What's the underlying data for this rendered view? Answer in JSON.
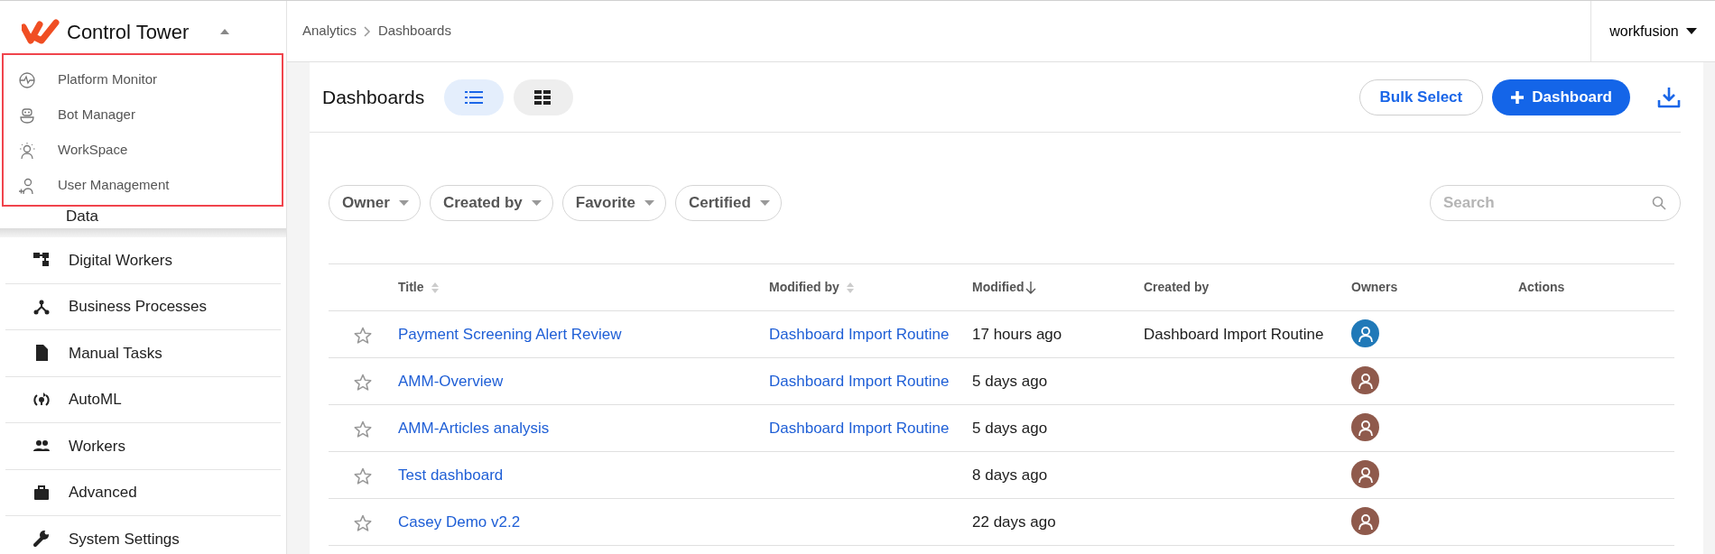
{
  "app": {
    "title": "Control Tower"
  },
  "app_menu": {
    "expanded": true,
    "items": [
      {
        "label": "Platform Monitor"
      },
      {
        "label": "Bot Manager"
      },
      {
        "label": "WorkSpace"
      },
      {
        "label": "User Management"
      }
    ]
  },
  "sidebar": {
    "items": [
      {
        "label": "Data"
      },
      {
        "label": "Digital Workers"
      },
      {
        "label": "Business Processes"
      },
      {
        "label": "Manual Tasks"
      },
      {
        "label": "AutoML"
      },
      {
        "label": "Workers"
      },
      {
        "label": "Advanced"
      },
      {
        "label": "System Settings"
      }
    ]
  },
  "breadcrumb": [
    "Analytics",
    "Dashboards"
  ],
  "user_menu": {
    "label": "workfusion"
  },
  "page": {
    "title": "Dashboards",
    "views": [
      {
        "kind": "list",
        "selected": true
      },
      {
        "kind": "grid",
        "selected": false
      }
    ],
    "buttons": [
      {
        "kind": "outline",
        "label": "Bulk Select"
      },
      {
        "kind": "primary",
        "label": "Dashboard"
      }
    ]
  },
  "filters": [
    "Owner",
    "Created by",
    "Favorite",
    "Certified"
  ],
  "search": {
    "placeholder": "Search"
  },
  "table": {
    "columns": [
      {
        "label": "Title",
        "sortable": true,
        "sorted_descending": false
      },
      {
        "label": "Modified by",
        "sortable": true,
        "sorted_descending": false
      },
      {
        "label": "Modified",
        "sortable": false,
        "sorted_descending": true
      },
      {
        "label": "Created by",
        "sortable": false,
        "sorted_descending": false
      },
      {
        "label": "Owners",
        "sortable": false,
        "sorted_descending": false
      },
      {
        "label": "Actions",
        "sortable": false,
        "sorted_descending": false
      }
    ],
    "rows": [
      {
        "favorite": false,
        "title": "Payment Screening Alert Review",
        "modified_by": "Dashboard Import Routine",
        "modified": "17 hours ago",
        "created_by": "Dashboard Import Routine",
        "owners": [
          {
            "color": "#2079b8"
          }
        ]
      },
      {
        "favorite": false,
        "title": "AMM-Overview",
        "modified_by": "Dashboard Import Routine",
        "modified": "5 days ago",
        "owners": [
          {
            "color": "#8f5a4c"
          }
        ]
      },
      {
        "favorite": false,
        "title": "AMM-Articles analysis",
        "modified_by": "Dashboard Import Routine",
        "modified": "5 days ago",
        "owners": [
          {
            "color": "#8f5a4c"
          }
        ]
      },
      {
        "favorite": false,
        "title": "Test dashboard",
        "modified": "8 days ago",
        "owners": [
          {
            "color": "#8f5a4c"
          }
        ]
      },
      {
        "favorite": false,
        "title": "Casey Demo v2.2",
        "modified": "22 days ago",
        "owners": [
          {
            "color": "#8f5a4c"
          }
        ]
      }
    ]
  }
}
